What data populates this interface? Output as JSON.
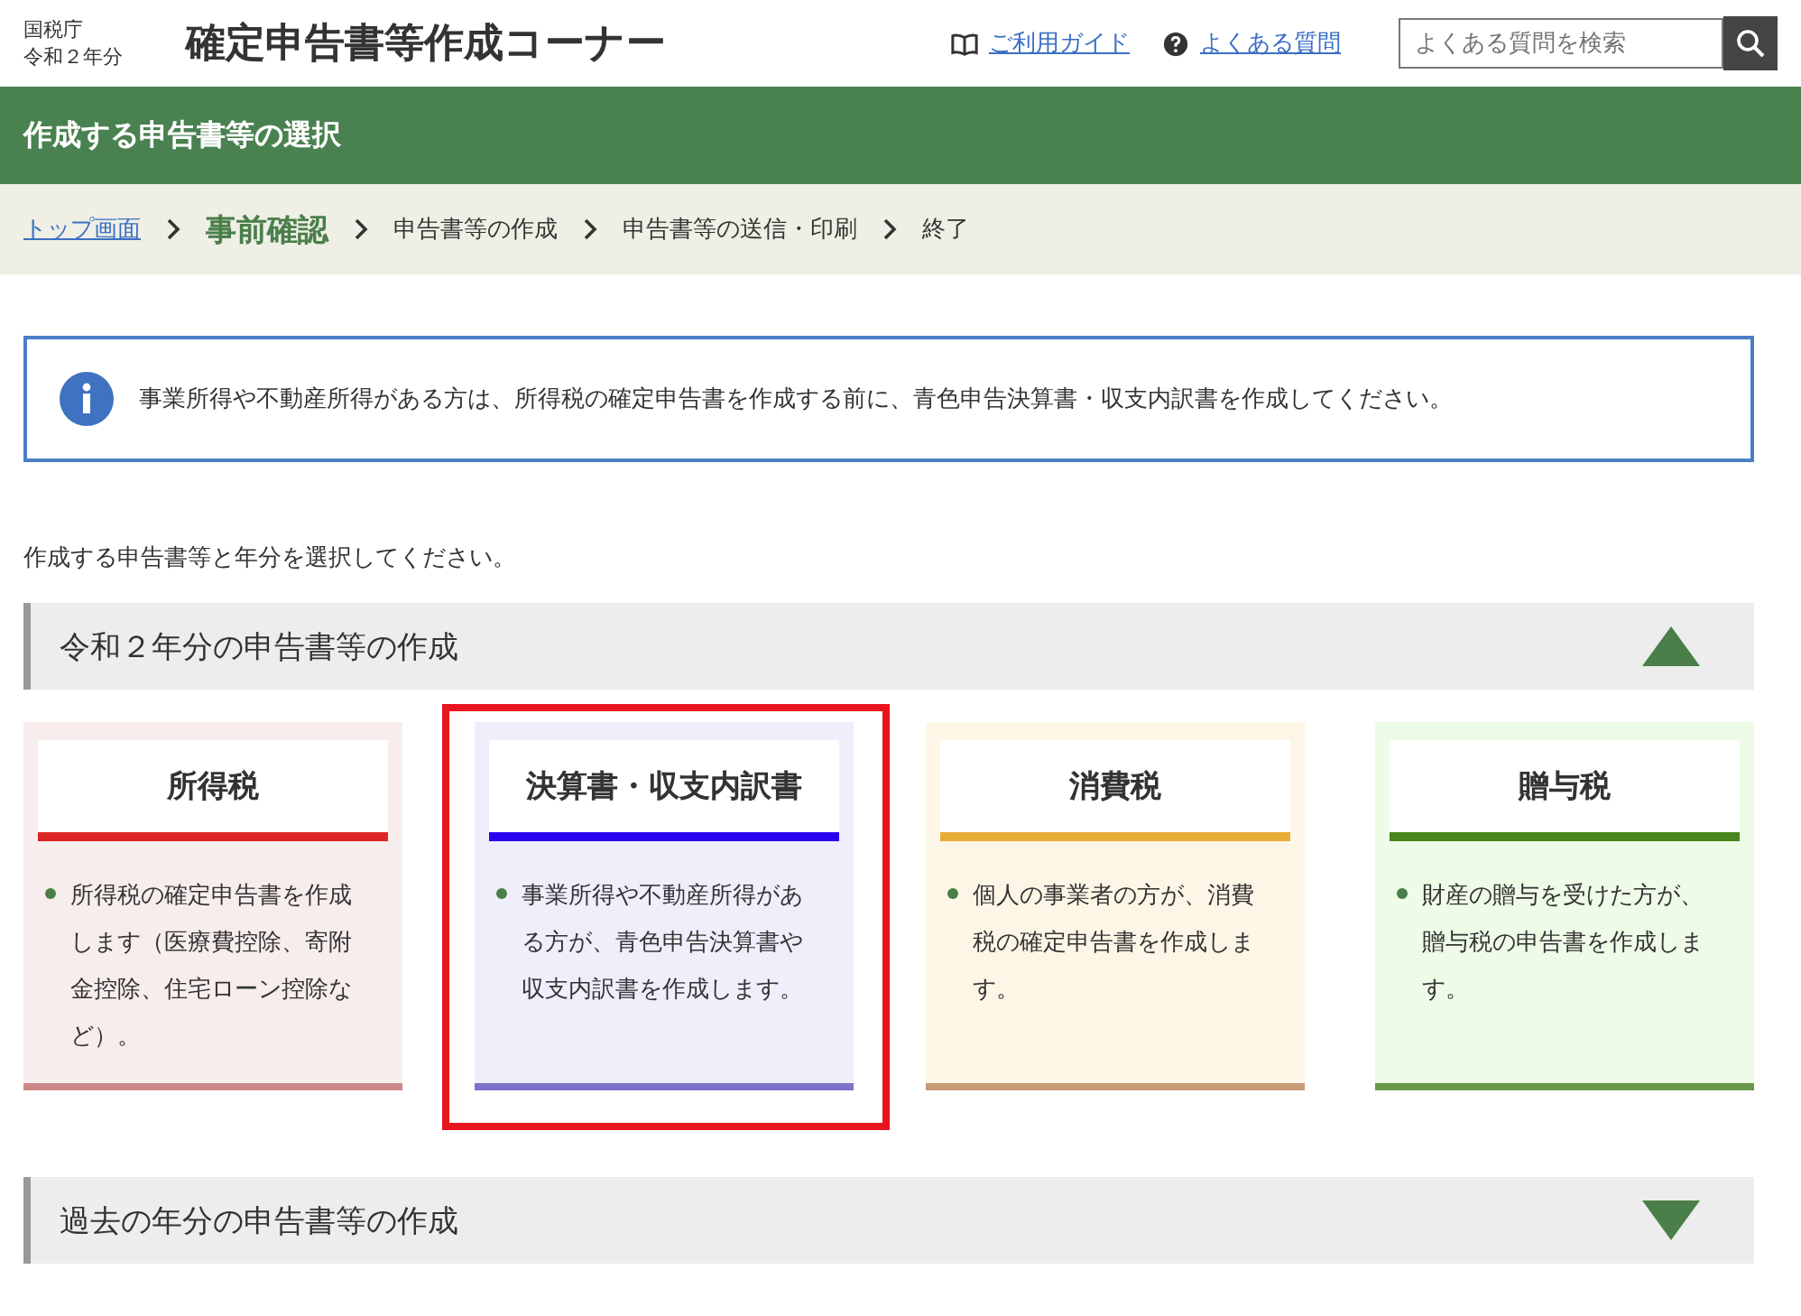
{
  "header": {
    "agency": "国税庁",
    "year": "令和２年分",
    "title": "確定申告書等作成コーナー",
    "links": [
      {
        "kind": "guide",
        "label": "ご利用ガイド"
      },
      {
        "kind": "faq",
        "label": "よくある質問"
      }
    ],
    "search": {
      "placeholder": "よくある質問を検索"
    }
  },
  "page_title": "作成する申告書等の選択",
  "breadcrumb": [
    {
      "kind": "link",
      "label": "トップ画面"
    },
    {
      "kind": "current",
      "label": "事前確認"
    },
    {
      "kind": "step",
      "label": "申告書等の作成"
    },
    {
      "kind": "step",
      "label": "申告書等の送信・印刷"
    },
    {
      "kind": "step",
      "label": "終了"
    }
  ],
  "notice": "事業所得や不動産所得がある方は、所得税の確定申告書を作成する前に、青色申告決算書・収支内訳書を作成してください。",
  "instruction": "作成する申告書等と年分を選択してください。",
  "sections": [
    {
      "title": "令和２年分の申告書等の作成",
      "expanded": true,
      "cards": [
        {
          "title": "所得税",
          "description": "所得税の確定申告書を作成します（医療費控除、寄附金控除、住宅ローン控除など）。",
          "color": "#dc2626",
          "selected": false
        },
        {
          "title": "決算書・収支内訳書",
          "description": "事業所得や不動産所得がある方が、青色申告決算書や収支内訳書を作成します。",
          "color": "#2a00f0",
          "selected": true
        },
        {
          "title": "消費税",
          "description": "個人の事業者の方が、消費税の確定申告書を作成します。",
          "color": "#e8ac38",
          "selected": false
        },
        {
          "title": "贈与税",
          "description": "財産の贈与を受けた方が、贈与税の申告書を作成します。",
          "color": "#46861c",
          "selected": false
        }
      ]
    },
    {
      "title": "過去の年分の申告書等の作成",
      "expanded": false
    }
  ]
}
